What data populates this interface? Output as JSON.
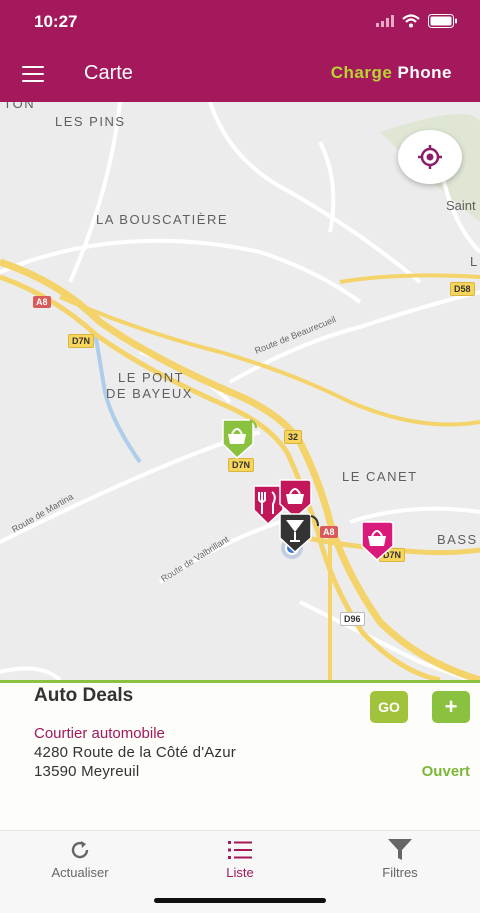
{
  "status_bar": {
    "time": "10:27"
  },
  "header": {
    "title": "Carte",
    "brand_part1": "Charge",
    "brand_part2": "Phone",
    "menu_icon": "hamburger-menu-icon",
    "accent_color": "#a3195b"
  },
  "map": {
    "places": {
      "ton": "TTON",
      "les_pins": "LES PINS",
      "bouscatiere": "LA BOUSCATIÈRE",
      "pont_line1": "LE PONT",
      "pont_line2": "DE BAYEUX",
      "le_canet": "LE CANET",
      "bass": "BASS",
      "saint": "Saint",
      "l": "L"
    },
    "roads": {
      "beaurecueil": "Route de Beaurecueil",
      "martina": "Route de Martina",
      "valbrillant": "Route de Valbrillant"
    },
    "shields": {
      "a8_left": "A8",
      "d7n_left": "D7N",
      "d58": "D58",
      "r32": "32",
      "d7n_center": "D7N",
      "a8_center": "A8",
      "d7n_right": "D7N",
      "d96": "D96"
    },
    "locate_icon": "crosshair-locate-icon",
    "pins": [
      "shopping-basket-pin-icon",
      "restaurant-pin-icon",
      "shopping-basket-pin-icon",
      "bar-cocktail-pin-icon",
      "shopping-basket-pin-icon"
    ]
  },
  "card": {
    "name": "Auto Deals",
    "category": "Courtier automobile",
    "address_line1": "4280 Route de la Côté d'Azur",
    "address_line2": "13590 Meyreuil",
    "status": "Ouvert",
    "go_label": "GO",
    "add_label": "+",
    "status_color": "#7cb73a"
  },
  "tabbar": {
    "tabs": [
      {
        "label": "Actualiser",
        "icon": "refresh-icon"
      },
      {
        "label": "Liste",
        "icon": "list-icon",
        "active": true
      },
      {
        "label": "Filtres",
        "icon": "filter-funnel-icon"
      }
    ]
  }
}
